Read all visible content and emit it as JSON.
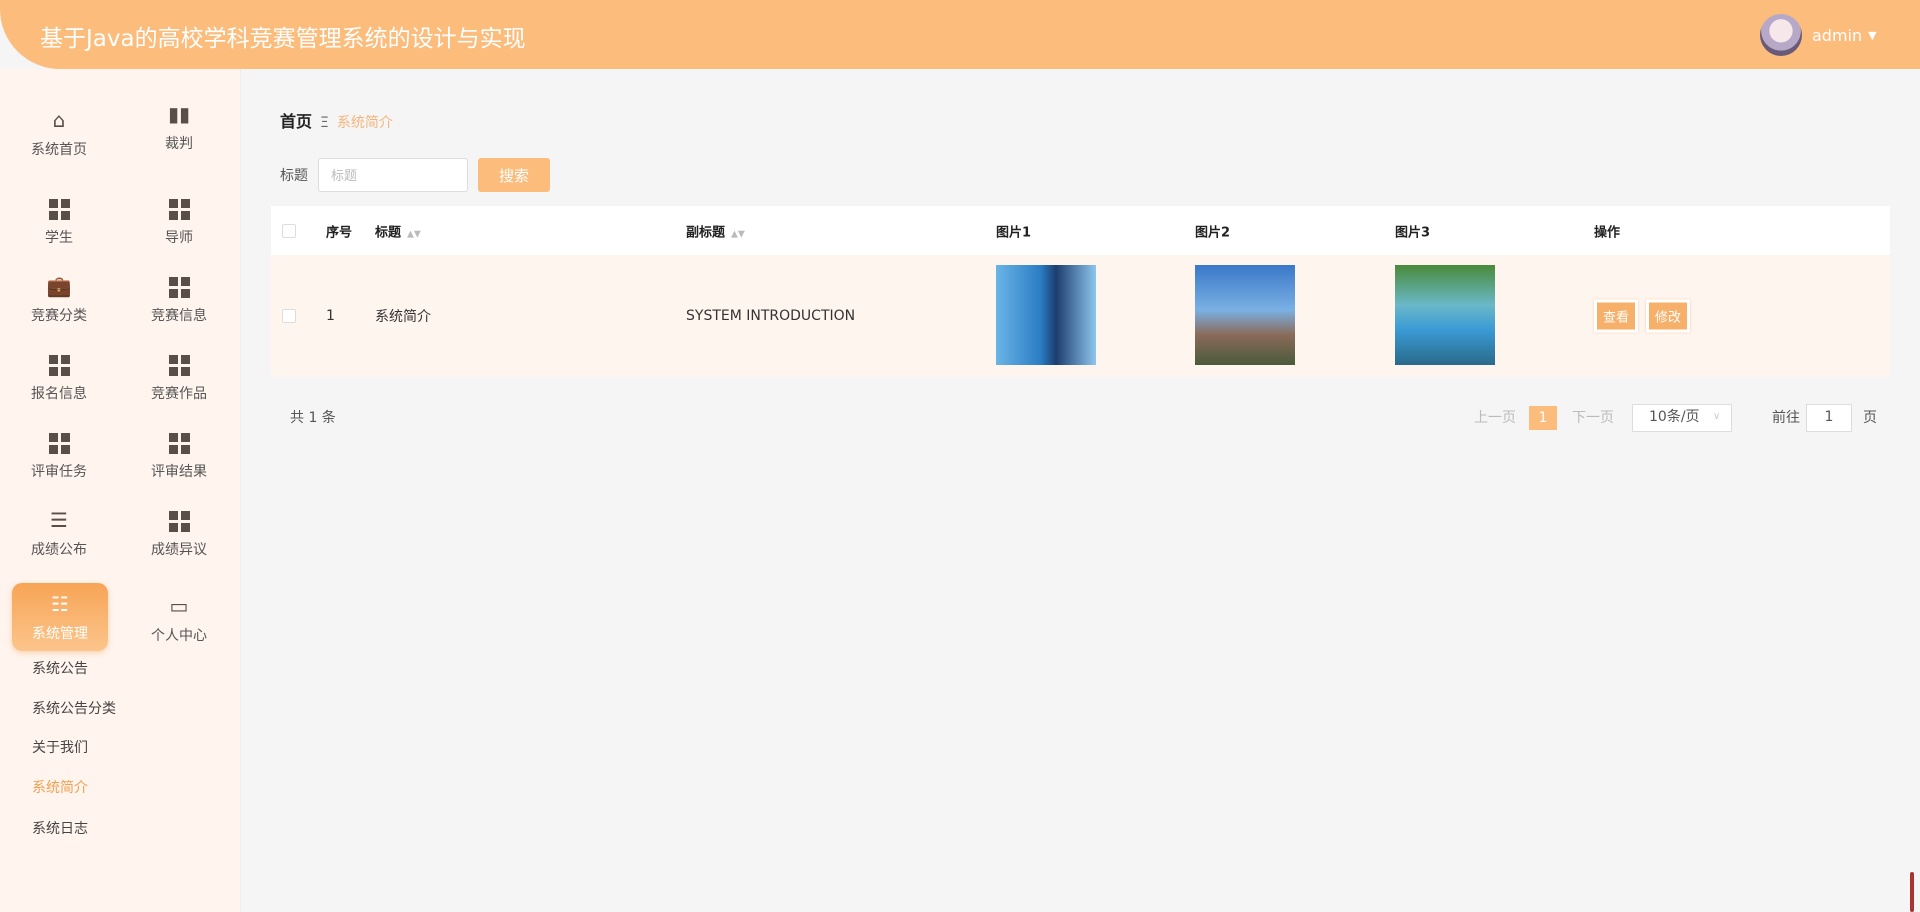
{
  "header": {
    "title": "基于Java的高校学科竞赛管理系统的设计与实现",
    "user": "admin",
    "brand_color": "#fbbc7c"
  },
  "sidebar": {
    "items": [
      {
        "label": "系统首页",
        "icon": "home-icon"
      },
      {
        "label": "裁判",
        "icon": "bar-chart-icon"
      },
      {
        "label": "学生",
        "icon": "grid-icon"
      },
      {
        "label": "导师",
        "icon": "grid-icon"
      },
      {
        "label": "竞赛分类",
        "icon": "briefcase-icon"
      },
      {
        "label": "竞赛信息",
        "icon": "grid-icon"
      },
      {
        "label": "报名信息",
        "icon": "grid-icon"
      },
      {
        "label": "竞赛作品",
        "icon": "grid-icon"
      },
      {
        "label": "评审任务",
        "icon": "grid-icon"
      },
      {
        "label": "评审结果",
        "icon": "grid-icon"
      },
      {
        "label": "成绩公布",
        "icon": "list-indent-icon"
      },
      {
        "label": "成绩异议",
        "icon": "grid-icon"
      },
      {
        "label": "系统管理",
        "icon": "sliders-icon",
        "active": true
      },
      {
        "label": "个人中心",
        "icon": "wallet-icon"
      }
    ],
    "submenu": [
      "系统公告",
      "系统公告分类",
      "关于我们",
      "系统简介",
      "系统日志"
    ],
    "submenu_active": "系统简介"
  },
  "breadcrumb": {
    "home": "首页",
    "sep": "Ξ",
    "current": "系统简介"
  },
  "search": {
    "label": "标题",
    "placeholder": "标题",
    "value": "",
    "button": "搜索"
  },
  "table": {
    "columns": [
      "序号",
      "标题",
      "副标题",
      "图片1",
      "图片2",
      "图片3",
      "操作"
    ],
    "rows": [
      {
        "index": "1",
        "title": "系统简介",
        "subtitle": "SYSTEM INTRODUCTION",
        "actions": [
          "查看",
          "修改"
        ]
      }
    ]
  },
  "pagination": {
    "total": "共 1 条",
    "prev": "上一页",
    "page": "1",
    "next": "下一页",
    "size": "10条/页",
    "goto": "前往",
    "goto_value": "1",
    "page_unit": "页"
  }
}
